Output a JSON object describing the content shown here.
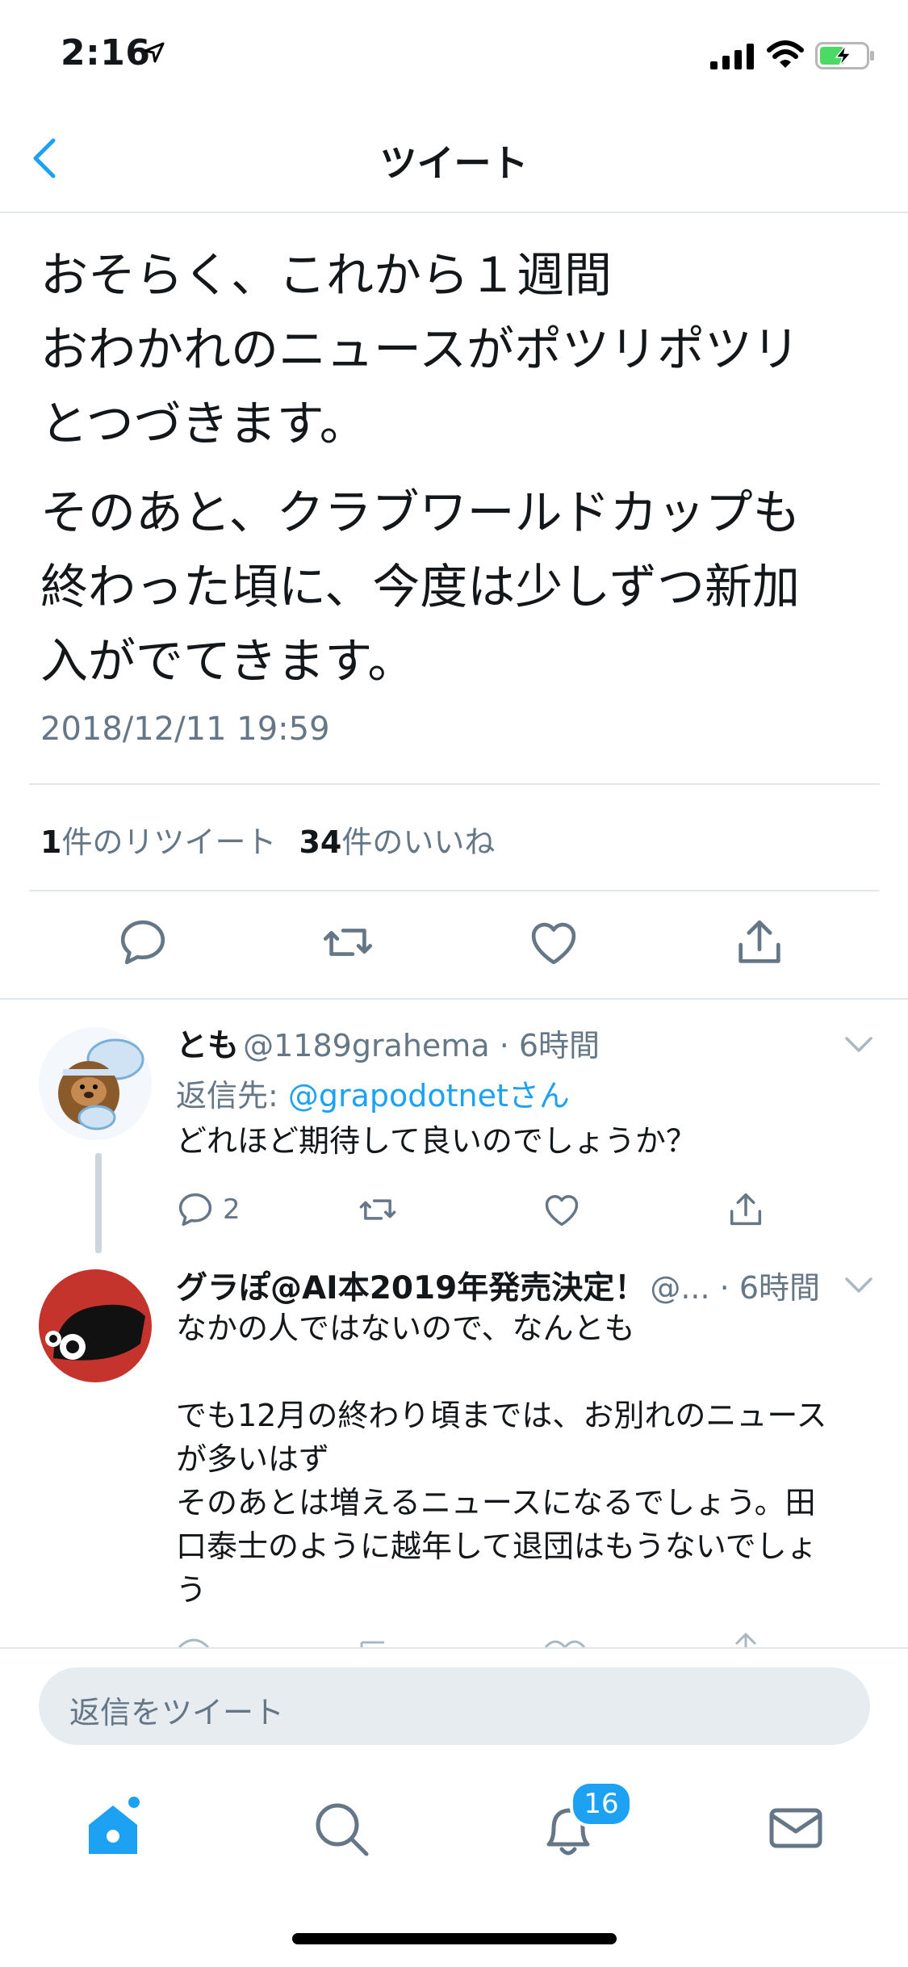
{
  "status_bar": {
    "time": "2:16"
  },
  "header": {
    "title": "ツイート"
  },
  "tweet": {
    "paragraphs": [
      "おそらく、これから１週間\nおわかれのニュースがポツリポツリ\nとつづきます。",
      "そのあと、クラブワールドカップも\n終わった頃に、今度は少しずつ新加\n入がでてきます。"
    ],
    "timestamp": "2018/12/11 19:59",
    "retweet_count": "1",
    "retweet_label": "件のリツイート",
    "like_count": "34",
    "like_label": "件のいいね"
  },
  "replies": [
    {
      "name": "とも",
      "handle": "@1189grahema · 6時間",
      "reply_to_label": "返信先: ",
      "reply_to_handle": "@grapodotnetさん",
      "text": "どれほど期待して良いのでしょうか？",
      "reply_count": "2"
    },
    {
      "name": "グラぽ@AI本2019年発売決定！",
      "handle": "@... · 6時間",
      "text": "なかの人ではないので、なんとも\n\nでも12月の終わり頃までは、お別れのニュース\nが多いはず\nそのあとは増えるニュースになるでしょう。田\n口泰士のように越年して退団はもうないでしょ\nう"
    }
  ],
  "reply_bar": {
    "placeholder": "返信をツイート"
  },
  "tab_bar": {
    "notification_badge": "16"
  },
  "colors": {
    "accent": "#1da1f2",
    "text": "#14171a",
    "secondary": "#657786",
    "divider": "#e1e8ed"
  }
}
